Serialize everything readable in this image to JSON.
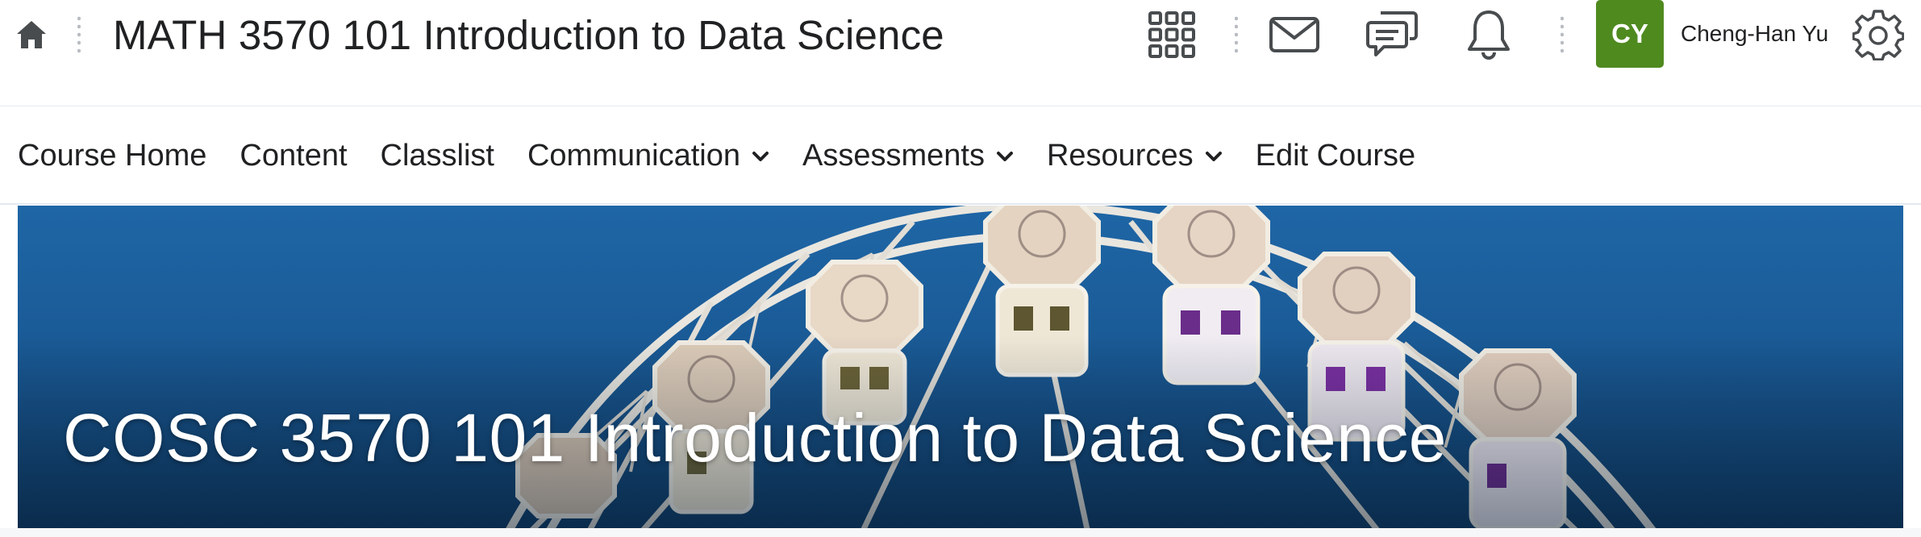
{
  "minibar": {
    "course_title": "MATH 3570 101 Introduction to Data Science",
    "icons": [
      "home-icon",
      "waffle-grid-icon",
      "mail-icon",
      "chat-icon",
      "bell-icon",
      "gear-icon"
    ],
    "user": {
      "initials": "CY",
      "name": "Cheng-Han Yu",
      "avatar_color": "#4f8a1f"
    }
  },
  "navbar": {
    "items": [
      {
        "label": "Course Home",
        "has_menu": false
      },
      {
        "label": "Content",
        "has_menu": false
      },
      {
        "label": "Classlist",
        "has_menu": false
      },
      {
        "label": "Communication",
        "has_menu": true
      },
      {
        "label": "Assessments",
        "has_menu": true
      },
      {
        "label": "Resources",
        "has_menu": true
      },
      {
        "label": "Edit Course",
        "has_menu": false
      }
    ]
  },
  "banner": {
    "title": "COSC 3570 101 Introduction to Data Science",
    "image": "ferris-wheel-image"
  }
}
